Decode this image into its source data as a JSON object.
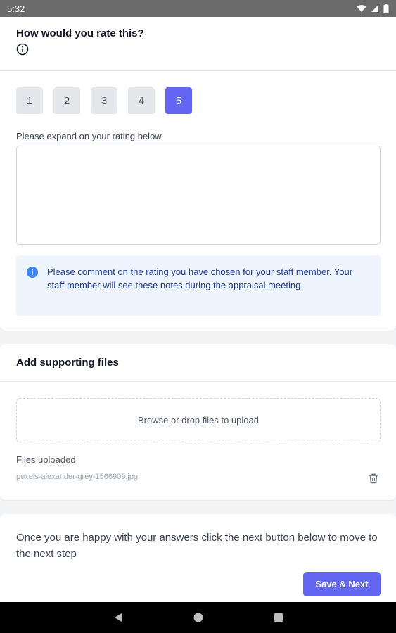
{
  "status_bar": {
    "time": "5:32",
    "icons": [
      "wifi-icon",
      "signal-icon",
      "battery-icon"
    ]
  },
  "rating": {
    "title": "How would you rate this?",
    "options": [
      "1",
      "2",
      "3",
      "4",
      "5"
    ],
    "selected": "5",
    "expand_label": "Please expand on your rating below",
    "comment_value": "",
    "note": "Please comment on the rating you have chosen for your staff member. Your staff member will see these notes during the appraisal meeting."
  },
  "files": {
    "title": "Add supporting files",
    "dropzone_text": "Browse or drop files to upload",
    "uploaded_label": "Files uploaded",
    "uploaded": [
      {
        "name": "pexels-alexander-grey-1566909.jpg"
      }
    ]
  },
  "next_step": {
    "text": "Once you are happy with your answers click the next button below to move to the next step",
    "button": "Save & Next"
  },
  "colors": {
    "accent": "#6366f1",
    "note_bg": "#eef5ff",
    "note_text": "#1e3a8a",
    "info_blue": "#3b82f6"
  }
}
